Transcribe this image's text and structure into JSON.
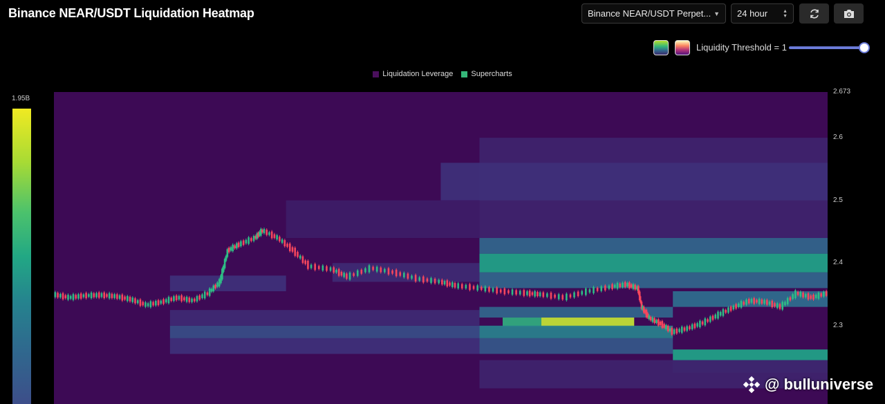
{
  "header": {
    "title": "Binance NEAR/USDT Liquidation Heatmap",
    "exchange_select": "Binance NEAR/USDT Perpet...",
    "period_select": "24 hour",
    "refresh_icon": "refresh-icon",
    "camera_icon": "camera-icon"
  },
  "controls": {
    "threshold_label": "Liquidity Threshold = 1",
    "threshold_value": 1,
    "palettes": [
      "viridis",
      "magma"
    ]
  },
  "legend": {
    "items": [
      {
        "label": "Liquidation Leverage",
        "color": "#4a0f5c"
      },
      {
        "label": "Supercharts",
        "color": "#35b779"
      }
    ]
  },
  "colorbar": {
    "max_label": "1.95B"
  },
  "watermark": {
    "text": "@ bulluniverse"
  },
  "colors": {
    "background": "#000000",
    "heat_low": "#3d0a55",
    "accent": "#6b7bd8"
  },
  "chart_data": {
    "type": "heatmap",
    "title": "Binance NEAR/USDT Liquidation Heatmap",
    "y_axis": {
      "ticks": [
        "2.673",
        "2.6",
        "2.5",
        "2.4",
        "2.3"
      ],
      "tick_values": [
        2.673,
        2.6,
        2.5,
        2.4,
        2.3
      ],
      "ylim": [
        2.175,
        2.673
      ]
    },
    "x_axis": {
      "range": [
        0,
        100
      ],
      "tick_labels": []
    },
    "colorbar_max": "1.95B",
    "bands": [
      {
        "y0": 2.385,
        "y1": 2.415,
        "x0": 55,
        "x1": 100,
        "v": 0.55
      },
      {
        "y0": 2.415,
        "y1": 2.44,
        "x0": 55,
        "x1": 100,
        "v": 0.3
      },
      {
        "y0": 2.36,
        "y1": 2.385,
        "x0": 55,
        "x1": 100,
        "v": 0.3
      },
      {
        "y0": 2.298,
        "y1": 2.313,
        "x0": 63,
        "x1": 75,
        "v": 0.92
      },
      {
        "y0": 2.298,
        "y1": 2.313,
        "x0": 58,
        "x1": 63,
        "v": 0.6
      },
      {
        "y0": 2.28,
        "y1": 2.3,
        "x0": 55,
        "x1": 80,
        "v": 0.4
      },
      {
        "y0": 2.313,
        "y1": 2.33,
        "x0": 55,
        "x1": 80,
        "v": 0.3
      },
      {
        "y0": 2.255,
        "y1": 2.28,
        "x0": 55,
        "x1": 80,
        "v": 0.25
      },
      {
        "y0": 2.245,
        "y1": 2.262,
        "x0": 80,
        "x1": 100,
        "v": 0.55
      },
      {
        "y0": 2.225,
        "y1": 2.245,
        "x0": 80,
        "x1": 100,
        "v": 0.28
      },
      {
        "y0": 2.33,
        "y1": 2.355,
        "x0": 80,
        "x1": 100,
        "v": 0.33
      },
      {
        "y0": 2.28,
        "y1": 2.3,
        "x0": 15,
        "x1": 55,
        "v": 0.22
      },
      {
        "y0": 2.255,
        "y1": 2.28,
        "x0": 15,
        "x1": 55,
        "v": 0.12
      },
      {
        "y0": 2.3,
        "y1": 2.325,
        "x0": 15,
        "x1": 55,
        "v": 0.1
      },
      {
        "y0": 2.355,
        "y1": 2.38,
        "x0": 15,
        "x1": 30,
        "v": 0.12
      },
      {
        "y0": 2.37,
        "y1": 2.4,
        "x0": 36,
        "x1": 55,
        "v": 0.1
      },
      {
        "y0": 2.44,
        "y1": 2.6,
        "x0": 55,
        "x1": 100,
        "v": 0.08
      },
      {
        "y0": 2.5,
        "y1": 2.56,
        "x0": 50,
        "x1": 100,
        "v": 0.12
      },
      {
        "y0": 2.44,
        "y1": 2.5,
        "x0": 30,
        "x1": 55,
        "v": 0.06
      },
      {
        "y0": 2.2,
        "y1": 2.245,
        "x0": 55,
        "x1": 100,
        "v": 0.08
      }
    ],
    "price": [
      {
        "x": 0,
        "y": 2.35
      },
      {
        "x": 2,
        "y": 2.345
      },
      {
        "x": 4,
        "y": 2.348
      },
      {
        "x": 6,
        "y": 2.349
      },
      {
        "x": 8,
        "y": 2.347
      },
      {
        "x": 10,
        "y": 2.342
      },
      {
        "x": 12,
        "y": 2.333
      },
      {
        "x": 14,
        "y": 2.338
      },
      {
        "x": 16,
        "y": 2.345
      },
      {
        "x": 18,
        "y": 2.34
      },
      {
        "x": 20,
        "y": 2.352
      },
      {
        "x": 21.5,
        "y": 2.37
      },
      {
        "x": 22.5,
        "y": 2.42
      },
      {
        "x": 24,
        "y": 2.43
      },
      {
        "x": 26,
        "y": 2.44
      },
      {
        "x": 27,
        "y": 2.452
      },
      {
        "x": 29,
        "y": 2.44
      },
      {
        "x": 31,
        "y": 2.42
      },
      {
        "x": 33,
        "y": 2.395
      },
      {
        "x": 36,
        "y": 2.39
      },
      {
        "x": 38,
        "y": 2.378
      },
      {
        "x": 41,
        "y": 2.392
      },
      {
        "x": 44,
        "y": 2.385
      },
      {
        "x": 47,
        "y": 2.375
      },
      {
        "x": 50,
        "y": 2.37
      },
      {
        "x": 52,
        "y": 2.364
      },
      {
        "x": 55,
        "y": 2.36
      },
      {
        "x": 58,
        "y": 2.355
      },
      {
        "x": 61,
        "y": 2.352
      },
      {
        "x": 63,
        "y": 2.35
      },
      {
        "x": 66,
        "y": 2.345
      },
      {
        "x": 69,
        "y": 2.355
      },
      {
        "x": 72,
        "y": 2.362
      },
      {
        "x": 74,
        "y": 2.366
      },
      {
        "x": 75.5,
        "y": 2.36
      },
      {
        "x": 76,
        "y": 2.33
      },
      {
        "x": 77,
        "y": 2.312
      },
      {
        "x": 78.5,
        "y": 2.303
      },
      {
        "x": 80,
        "y": 2.29
      },
      {
        "x": 82,
        "y": 2.296
      },
      {
        "x": 84,
        "y": 2.305
      },
      {
        "x": 86,
        "y": 2.318
      },
      {
        "x": 88,
        "y": 2.33
      },
      {
        "x": 90,
        "y": 2.34
      },
      {
        "x": 92,
        "y": 2.338
      },
      {
        "x": 94,
        "y": 2.33
      },
      {
        "x": 96,
        "y": 2.352
      },
      {
        "x": 98,
        "y": 2.345
      },
      {
        "x": 100,
        "y": 2.352
      }
    ]
  }
}
